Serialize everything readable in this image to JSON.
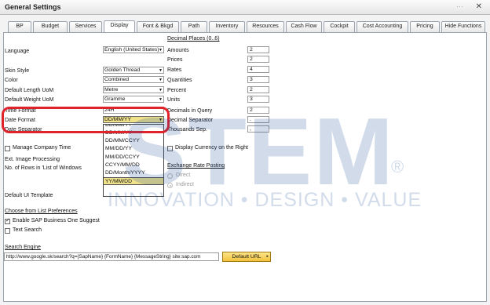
{
  "window": {
    "title": "General Settings",
    "close": "✕",
    "dots": "⋯"
  },
  "tabs": [
    "BP",
    "Budget",
    "Services",
    "Display",
    "Font & Bkgd",
    "Path",
    "Inventory",
    "Resources",
    "Cash Flow",
    "Cockpit",
    "Cost Accounting",
    "Pricing",
    "Hide Functions"
  ],
  "active_tab": "Display",
  "left": {
    "language_label": "Language",
    "language_value": "English (United States)",
    "skin_label": "Skin Style",
    "skin_value": "Golden Thread",
    "color_label": "Color",
    "color_value": "Combined",
    "length_label": "Default Length UoM",
    "length_value": "Metre",
    "weight_label": "Default Weight UoM",
    "weight_value": "Gramme",
    "time_label": "Time Format",
    "time_value": "24H",
    "date_label": "Date Format",
    "date_value": "DD/MM/YY",
    "datesep_label": "Date Separator",
    "manage_time_label": "Manage Company Time",
    "ext_image_label": "Ext. Image Processing",
    "rows_label": "No. of Rows in 'List of Windows",
    "ui_template_label": "Default UI Template"
  },
  "date_dropdown": {
    "options": [
      "DD/MM/YY",
      "DD/MM/CCYY",
      "MM/DD/YY",
      "MM/DD/CCYY",
      "CCYY/MM/DD",
      "DD/Month/YYYY",
      "YY/MM/DD"
    ],
    "highlighted": "YY/MM/DD"
  },
  "decimal": {
    "header": "Decimal Places (0..6)",
    "rows": [
      {
        "label": "Amounts",
        "value": "2"
      },
      {
        "label": "Prices",
        "value": "2"
      },
      {
        "label": "Rates",
        "value": "4"
      },
      {
        "label": "Quantities",
        "value": "3"
      },
      {
        "label": "Percent",
        "value": "2"
      },
      {
        "label": "Units",
        "value": "3"
      },
      {
        "label": "Decimals in Query",
        "value": "2"
      }
    ],
    "decimal_sep_label": "Decimal Separator",
    "decimal_sep_value": ".",
    "thousands_label": "Thousands Sep.",
    "thousands_value": ","
  },
  "display_currency_label": "Display Currency on the Right",
  "exchange": {
    "header": "Exchange Rate Posting",
    "direct": "Direct",
    "indirect": "Indirect"
  },
  "choose_list": {
    "header": "Choose from List Preferences",
    "enable_label": "Enable SAP Business One Suggest",
    "text_search_label": "Text Search"
  },
  "search_engine": {
    "header": "Search Engine",
    "value": "http://www.google.sk/search?q={SapName} {FormName} {MessageString} site:sap.com",
    "button": "Default URL"
  },
  "watermark": {
    "big": "STEM",
    "sub": "INNOVATION • DESIGN • VALUE",
    "reg": "®"
  },
  "colors": {
    "highlight": "#f0e28a",
    "callout": "#e0222b",
    "watermark": "#1f4e9a",
    "button": "#f2c23c"
  },
  "icons": {
    "dropdown": "dropdown-arrow-icon",
    "check": "check-icon",
    "close": "close-icon"
  }
}
